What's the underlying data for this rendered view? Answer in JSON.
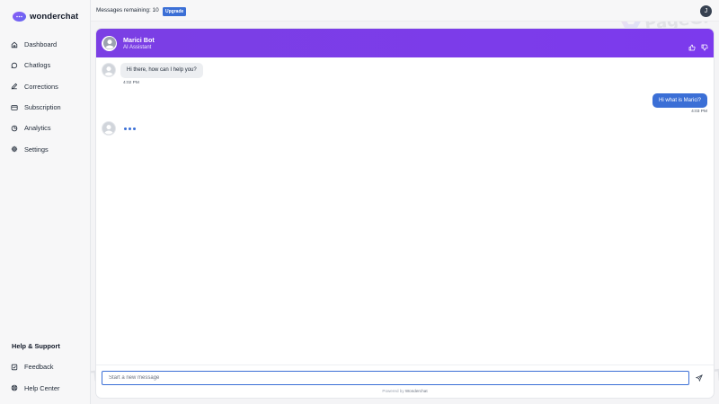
{
  "app": {
    "brand": "wonderchat",
    "messages_remaining": "Messages remaining: 10",
    "upgrade_label": "Upgrade",
    "user_initial": "J"
  },
  "sidebar": {
    "items": [
      {
        "label": "Dashboard",
        "icon": "home-icon"
      },
      {
        "label": "Chatlogs",
        "icon": "chat-bubble-icon"
      },
      {
        "label": "Corrections",
        "icon": "pencil-icon"
      },
      {
        "label": "Subscription",
        "icon": "credit-card-icon"
      },
      {
        "label": "Analytics",
        "icon": "pie-chart-icon"
      },
      {
        "label": "Settings",
        "icon": "gear-icon"
      }
    ],
    "help_title": "Help & Support",
    "help_items": [
      {
        "label": "Feedback",
        "icon": "checkbox-icon"
      },
      {
        "label": "Help Center",
        "icon": "lifebuoy-icon"
      }
    ]
  },
  "chat": {
    "bot_name": "Marici Bot",
    "bot_role": "AI Assistant",
    "messages": [
      {
        "from": "bot",
        "text": "Hi there, how can I help you?",
        "time": "4:02 PM"
      },
      {
        "from": "user",
        "text": "Hi what is Marici?",
        "time": "4:03 PM"
      }
    ],
    "input_placeholder": "Start a new message",
    "powered_prefix": "Powered by",
    "powered_brand": "Wonderchat"
  },
  "watermark": {
    "text": "PageGPT"
  },
  "colors": {
    "header": "#7c3aed",
    "accent": "#3b6fd6"
  }
}
